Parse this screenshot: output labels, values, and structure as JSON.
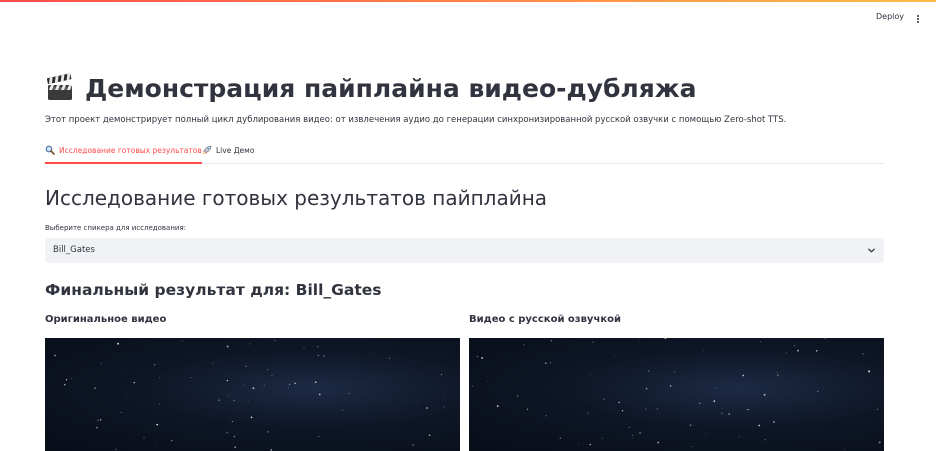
{
  "header": {
    "deploy_label": "Deploy"
  },
  "page": {
    "title_emoji": "🎬",
    "title": "Демонстрация пайплайна видео-дубляжа",
    "subtitle": "Этот проект демонстрирует полный цикл дублирования видео: от извлечения аудио до генерации синхронизированной русской озвучки с помощью Zero-shot TTS."
  },
  "tabs": [
    {
      "label": "Исследование готовых результатов",
      "icon": "magnifier-icon",
      "active": true
    },
    {
      "label": "Live Демо",
      "icon": "rocket-icon",
      "active": false
    }
  ],
  "section": {
    "heading": "Исследование готовых результатов пайплайна",
    "select_label": "Выберите спикера для исследования:",
    "select_value": "Bill_Gates",
    "result_heading": "Финальный результат для: Bill_Gates"
  },
  "columns": [
    {
      "title": "Оригинальное видео"
    },
    {
      "title": "Видео с русской озвучкой"
    }
  ],
  "colors": {
    "accent": "#ff4b4b",
    "text": "#31333f",
    "select_bg": "#f0f2f6",
    "video_bg": "#0b1220"
  }
}
